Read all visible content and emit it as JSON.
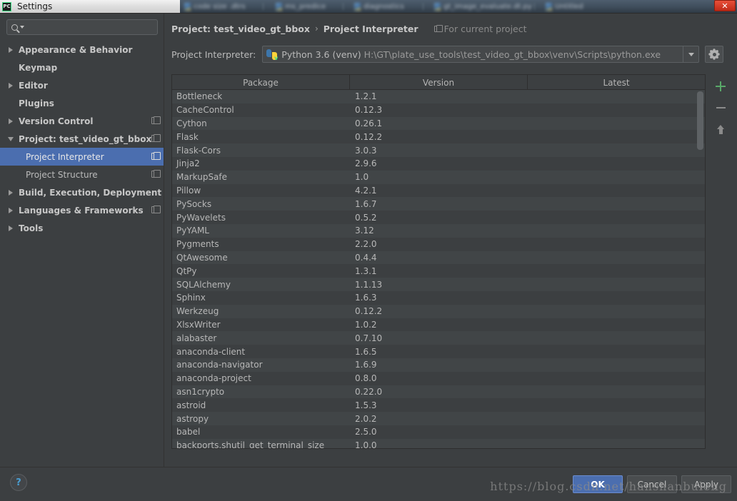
{
  "window": {
    "title": "Settings",
    "app_icon": "pycharm-icon",
    "close_label": "✕"
  },
  "background_strip": {
    "tabs": [
      "code size .dtrs",
      "ms_predice",
      "diagnostics",
      "gt_image_evaluate.dt.py",
      "Untitled"
    ]
  },
  "search": {
    "value": "",
    "placeholder": ""
  },
  "sidebar": {
    "items": [
      {
        "label": "Appearance & Behavior",
        "twisty": "right",
        "bold": true,
        "indent": false,
        "copy": false,
        "selected": false
      },
      {
        "label": "Keymap",
        "twisty": "none",
        "bold": true,
        "indent": false,
        "copy": false,
        "selected": false
      },
      {
        "label": "Editor",
        "twisty": "right",
        "bold": true,
        "indent": false,
        "copy": false,
        "selected": false
      },
      {
        "label": "Plugins",
        "twisty": "none",
        "bold": true,
        "indent": false,
        "copy": false,
        "selected": false
      },
      {
        "label": "Version Control",
        "twisty": "right",
        "bold": true,
        "indent": false,
        "copy": true,
        "selected": false
      },
      {
        "label": "Project: test_video_gt_bbox",
        "twisty": "down",
        "bold": true,
        "indent": false,
        "copy": true,
        "selected": false
      },
      {
        "label": "Project Interpreter",
        "twisty": "none",
        "bold": false,
        "indent": true,
        "copy": true,
        "selected": true
      },
      {
        "label": "Project Structure",
        "twisty": "none",
        "bold": false,
        "indent": true,
        "copy": true,
        "selected": false
      },
      {
        "label": "Build, Execution, Deployment",
        "twisty": "right",
        "bold": true,
        "indent": false,
        "copy": false,
        "selected": false
      },
      {
        "label": "Languages & Frameworks",
        "twisty": "right",
        "bold": true,
        "indent": false,
        "copy": true,
        "selected": false
      },
      {
        "label": "Tools",
        "twisty": "right",
        "bold": true,
        "indent": false,
        "copy": false,
        "selected": false
      }
    ]
  },
  "breadcrumb": {
    "project": "Project: test_video_gt_bbox",
    "separator": "›",
    "page": "Project Interpreter",
    "scope_note": "For current project"
  },
  "interpreter": {
    "label": "Project Interpreter:",
    "name": "Python 3.6 (venv) ",
    "path": "H:\\GT\\plate_use_tools\\test_video_gt_bbox\\venv\\Scripts\\python.exe",
    "icon": "python-venv-icon",
    "settings_button": "gear-icon"
  },
  "packages_table": {
    "columns": [
      "Package",
      "Version",
      "Latest"
    ],
    "rows": [
      [
        "Bottleneck",
        "1.2.1",
        ""
      ],
      [
        "CacheControl",
        "0.12.3",
        ""
      ],
      [
        "Cython",
        "0.26.1",
        ""
      ],
      [
        "Flask",
        "0.12.2",
        ""
      ],
      [
        "Flask-Cors",
        "3.0.3",
        ""
      ],
      [
        "Jinja2",
        "2.9.6",
        ""
      ],
      [
        "MarkupSafe",
        "1.0",
        ""
      ],
      [
        "Pillow",
        "4.2.1",
        ""
      ],
      [
        "PySocks",
        "1.6.7",
        ""
      ],
      [
        "PyWavelets",
        "0.5.2",
        ""
      ],
      [
        "PyYAML",
        "3.12",
        ""
      ],
      [
        "Pygments",
        "2.2.0",
        ""
      ],
      [
        "QtAwesome",
        "0.4.4",
        ""
      ],
      [
        "QtPy",
        "1.3.1",
        ""
      ],
      [
        "SQLAlchemy",
        "1.1.13",
        ""
      ],
      [
        "Sphinx",
        "1.6.3",
        ""
      ],
      [
        "Werkzeug",
        "0.12.2",
        ""
      ],
      [
        "XlsxWriter",
        "1.0.2",
        ""
      ],
      [
        "alabaster",
        "0.7.10",
        ""
      ],
      [
        "anaconda-client",
        "1.6.5",
        ""
      ],
      [
        "anaconda-navigator",
        "1.6.9",
        ""
      ],
      [
        "anaconda-project",
        "0.8.0",
        ""
      ],
      [
        "asn1crypto",
        "0.22.0",
        ""
      ],
      [
        "astroid",
        "1.5.3",
        ""
      ],
      [
        "astropy",
        "2.0.2",
        ""
      ],
      [
        "babel",
        "2.5.0",
        ""
      ],
      [
        "backports.shutil_get_terminal_size",
        "1.0.0",
        ""
      ]
    ]
  },
  "package_tools": {
    "add": "+",
    "remove": "−",
    "upgrade": "↑"
  },
  "footer": {
    "help": "?",
    "ok": "OK",
    "cancel": "Cancel",
    "apply": "Apply"
  },
  "watermark": {
    "text": "https://blog.csdn.net/hanshanbuleng"
  },
  "colors": {
    "background": "#3c3f41",
    "selection": "#4b6eaf",
    "accent_green": "#59a869",
    "annotation_circle": "#1a16e8",
    "help_blue": "#4a9fd4"
  }
}
